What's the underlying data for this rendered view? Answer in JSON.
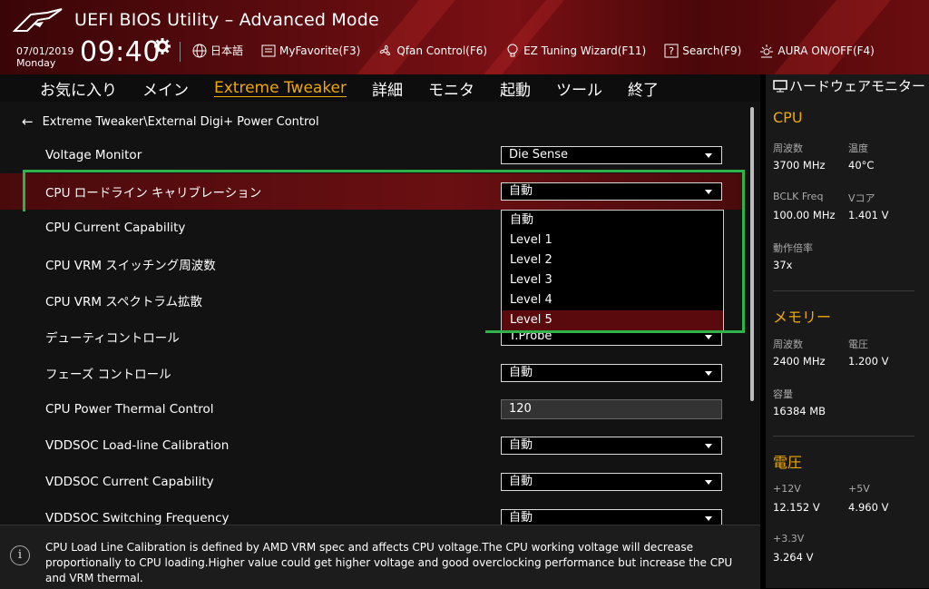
{
  "header": {
    "title": "UEFI BIOS Utility – Advanced Mode",
    "date": "07/01/2019",
    "day": "Monday",
    "time": "09:40",
    "toolbar": [
      {
        "icon": "globe-icon",
        "label": "日本語"
      },
      {
        "icon": "favorite-icon",
        "label": "MyFavorite(F3)"
      },
      {
        "icon": "fan-icon",
        "label": "Qfan Control(F6)"
      },
      {
        "icon": "bulb-icon",
        "label": "EZ Tuning Wizard(F11)"
      },
      {
        "icon": "search-icon",
        "label": "Search(F9)"
      },
      {
        "icon": "aura-icon",
        "label": "AURA ON/OFF(F4)"
      }
    ]
  },
  "nav": {
    "tabs": [
      "お気に入り",
      "メイン",
      "Extreme Tweaker",
      "詳細",
      "モニタ",
      "起動",
      "ツール",
      "終了"
    ],
    "active": "Extreme Tweaker"
  },
  "breadcrumb": "Extreme Tweaker\\External Digi+ Power Control",
  "settings": [
    {
      "label": "Voltage Monitor",
      "value": "Die Sense",
      "type": "select"
    },
    {
      "label": "CPU ロードライン キャリブレーション",
      "value": "自動",
      "type": "select"
    },
    {
      "label": "CPU Current Capability",
      "value": "",
      "type": "none"
    },
    {
      "label": "CPU VRM スイッチング周波数",
      "value": "",
      "type": "none"
    },
    {
      "label": "CPU VRM スペクトラム拡散",
      "value": "",
      "type": "none"
    },
    {
      "label": "デューティコントロール",
      "value": "T.Probe",
      "type": "select"
    },
    {
      "label": "フェーズ コントロール",
      "value": "自動",
      "type": "select"
    },
    {
      "label": "CPU Power Thermal Control",
      "value": "120",
      "type": "text"
    },
    {
      "label": "VDDSOC Load-line Calibration",
      "value": "自動",
      "type": "select"
    },
    {
      "label": "VDDSOC Current Capability",
      "value": "自動",
      "type": "select"
    },
    {
      "label": "VDDSOC Switching Frequency",
      "value": "自動",
      "type": "select"
    }
  ],
  "dropdown": {
    "options": [
      "自動",
      "Level 1",
      "Level 2",
      "Level 3",
      "Level 4",
      "Level 5"
    ],
    "selected": "Level 5"
  },
  "help": {
    "text": "CPU Load Line Calibration is defined by AMD VRM spec and affects CPU voltage.The CPU working voltage will decrease proportionally to CPU loading.Higher value could get higher voltage and good overclocking performance but increase the CPU and VRM thermal."
  },
  "hardware_monitor": {
    "title": "ハードウェアモニター",
    "cpu": {
      "heading": "CPU",
      "freq_label": "周波数",
      "freq": "3700 MHz",
      "temp_label": "温度",
      "temp": "40°C",
      "bclk_label": "BCLK Freq",
      "bclk": "100.00 MHz",
      "vcore_label": "Vコア",
      "vcore": "1.401 V",
      "ratio_label": "動作倍率",
      "ratio": "37x"
    },
    "memory": {
      "heading": "メモリー",
      "freq_label": "周波数",
      "freq": "2400 MHz",
      "volt_label": "電圧",
      "volt": "1.200 V",
      "cap_label": "容量",
      "cap": "16384 MB"
    },
    "voltage": {
      "heading": "電圧",
      "v12_label": "+12V",
      "v12": "12.152 V",
      "v5_label": "+5V",
      "v5": "4.960 V",
      "v33_label": "+3.3V",
      "v33": "3.264 V"
    }
  },
  "colors": {
    "accent": "#f0a800",
    "highlight": "#5a0a0c",
    "annotation": "#2fb24a"
  }
}
